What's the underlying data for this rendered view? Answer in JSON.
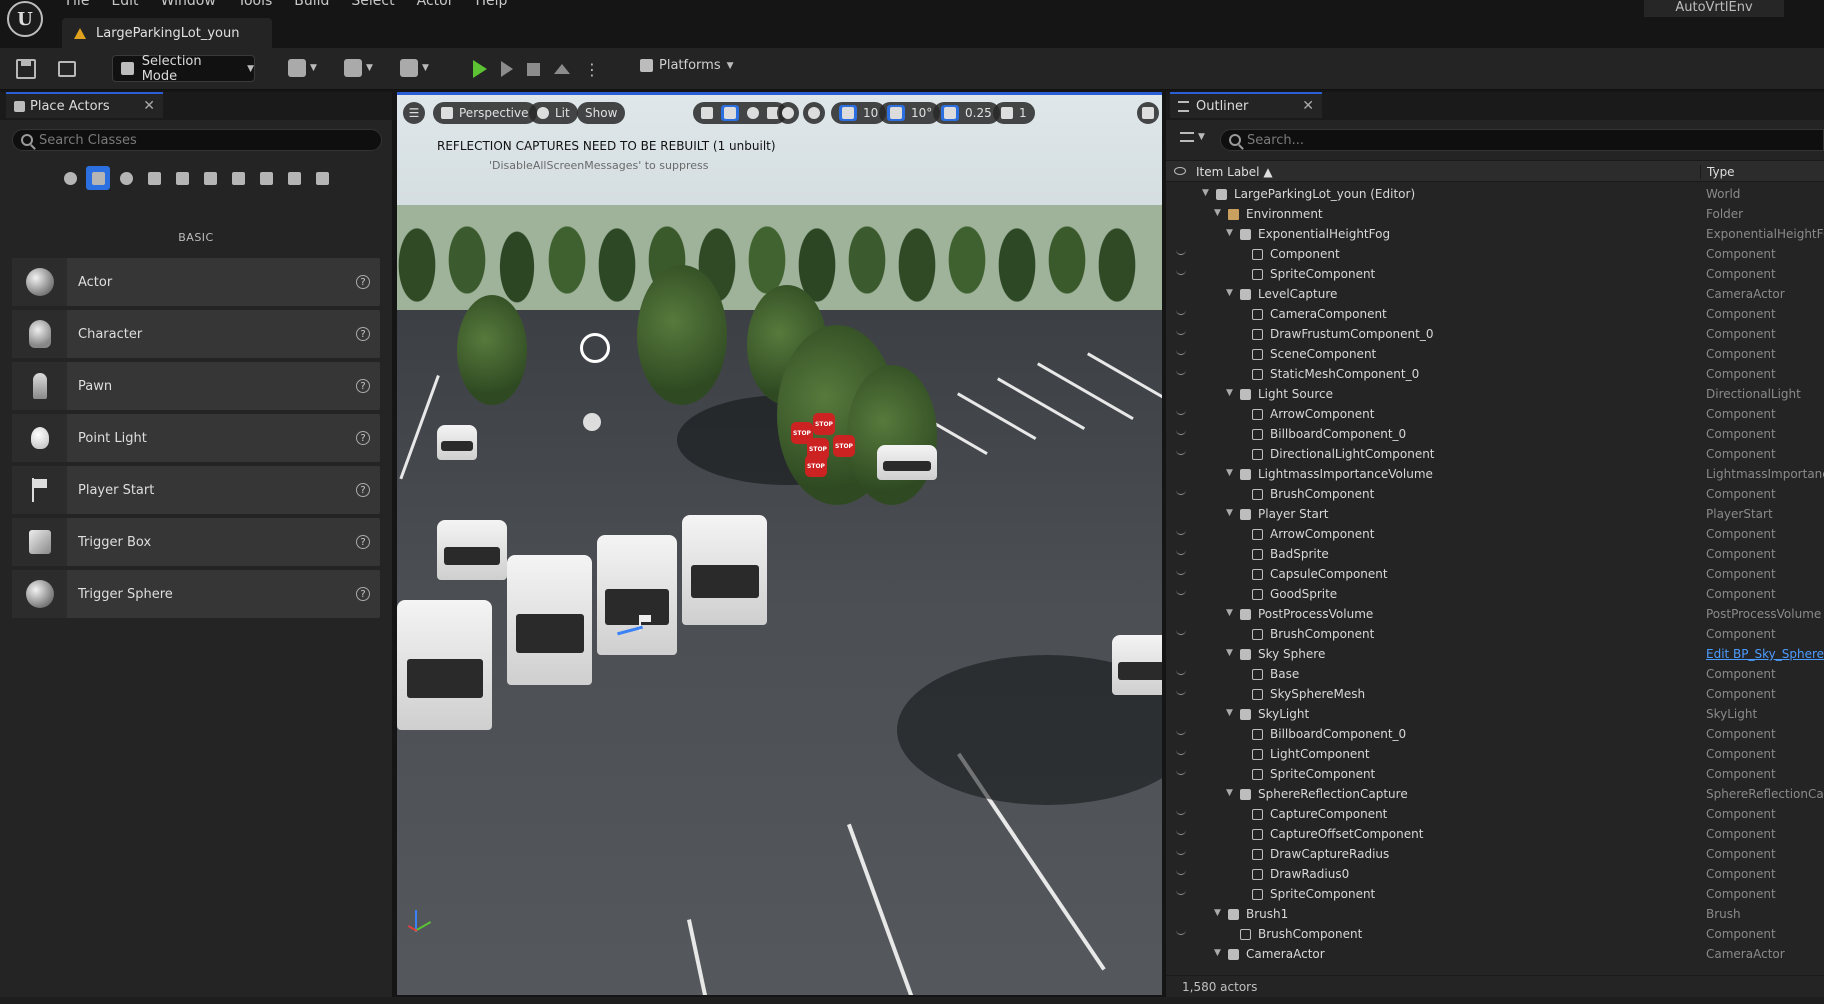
{
  "app": {
    "menu": [
      "File",
      "Edit",
      "Window",
      "Tools",
      "Build",
      "Select",
      "Actor",
      "Help"
    ],
    "doc_tab": "LargeParkingLot_youn",
    "project": "AutoVrtlEnv"
  },
  "toolbar": {
    "selection_mode": "Selection Mode",
    "platforms": "Platforms"
  },
  "place_actors": {
    "tab_title": "Place Actors",
    "search_placeholder": "Search Classes",
    "section": "BASIC",
    "items": [
      {
        "label": "Actor",
        "icon": "sphere-icon"
      },
      {
        "label": "Character",
        "icon": "character-icon"
      },
      {
        "label": "Pawn",
        "icon": "pawn-icon"
      },
      {
        "label": "Point Light",
        "icon": "point-light-icon"
      },
      {
        "label": "Player Start",
        "icon": "player-start-icon"
      },
      {
        "label": "Trigger Box",
        "icon": "trigger-box-icon"
      },
      {
        "label": "Trigger Sphere",
        "icon": "trigger-sphere-icon"
      }
    ]
  },
  "viewport": {
    "perspective": "Perspective",
    "lit": "Lit",
    "show": "Show",
    "grid_snap": "10",
    "rot_snap": "10°",
    "scale_snap": "0.25",
    "camera_speed": "1",
    "message": "REFLECTION CAPTURES NEED TO BE REBUILT (1 unbuilt)",
    "message_hint": "'DisableAllScreenMessages' to suppress",
    "stop_label": "STOP"
  },
  "outliner": {
    "tab_title": "Outliner",
    "search_placeholder": "Search...",
    "col_label": "Item Label ▲",
    "col_type": "Type",
    "footer": "1,580 actors",
    "rows": [
      {
        "name": "LargeParkingLot_youn (Editor)",
        "type": "World"
      },
      {
        "name": "Environment",
        "type": "Folder"
      },
      {
        "name": "ExponentialHeightFog",
        "type": "ExponentialHeightFo"
      },
      {
        "name": "Component",
        "type": "Component"
      },
      {
        "name": "SpriteComponent",
        "type": "Component"
      },
      {
        "name": "LevelCapture",
        "type": "CameraActor"
      },
      {
        "name": "CameraComponent",
        "type": "Component"
      },
      {
        "name": "DrawFrustumComponent_0",
        "type": "Component"
      },
      {
        "name": "SceneComponent",
        "type": "Component"
      },
      {
        "name": "StaticMeshComponent_0",
        "type": "Component"
      },
      {
        "name": "Light Source",
        "type": "DirectionalLight"
      },
      {
        "name": "ArrowComponent",
        "type": "Component"
      },
      {
        "name": "BillboardComponent_0",
        "type": "Component"
      },
      {
        "name": "DirectionalLightComponent",
        "type": "Component"
      },
      {
        "name": "LightmassImportanceVolume",
        "type": "LightmassImportanc"
      },
      {
        "name": "BrushComponent",
        "type": "Component"
      },
      {
        "name": "Player Start",
        "type": "PlayerStart"
      },
      {
        "name": "ArrowComponent",
        "type": "Component"
      },
      {
        "name": "BadSprite",
        "type": "Component"
      },
      {
        "name": "CapsuleComponent",
        "type": "Component"
      },
      {
        "name": "GoodSprite",
        "type": "Component"
      },
      {
        "name": "PostProcessVolume",
        "type": "PostProcessVolume"
      },
      {
        "name": "BrushComponent",
        "type": "Component"
      },
      {
        "name": "Sky Sphere",
        "type": "Edit BP_Sky_Sphere"
      },
      {
        "name": "Base",
        "type": "Component"
      },
      {
        "name": "SkySphereMesh",
        "type": "Component"
      },
      {
        "name": "SkyLight",
        "type": "SkyLight"
      },
      {
        "name": "BillboardComponent_0",
        "type": "Component"
      },
      {
        "name": "LightComponent",
        "type": "Component"
      },
      {
        "name": "SpriteComponent",
        "type": "Component"
      },
      {
        "name": "SphereReflectionCapture",
        "type": "SphereReflectionCap"
      },
      {
        "name": "CaptureComponent",
        "type": "Component"
      },
      {
        "name": "CaptureOffsetComponent",
        "type": "Component"
      },
      {
        "name": "DrawCaptureRadius",
        "type": "Component"
      },
      {
        "name": "DrawRadius0",
        "type": "Component"
      },
      {
        "name": "SpriteComponent",
        "type": "Component"
      },
      {
        "name": "Brush1",
        "type": "Brush"
      },
      {
        "name": "BrushComponent",
        "type": "Component"
      },
      {
        "name": "CameraActor",
        "type": "CameraActor"
      }
    ]
  },
  "colors": {
    "accent": "#2b5fd5",
    "play": "#5cc234",
    "link": "#4d9cff"
  }
}
